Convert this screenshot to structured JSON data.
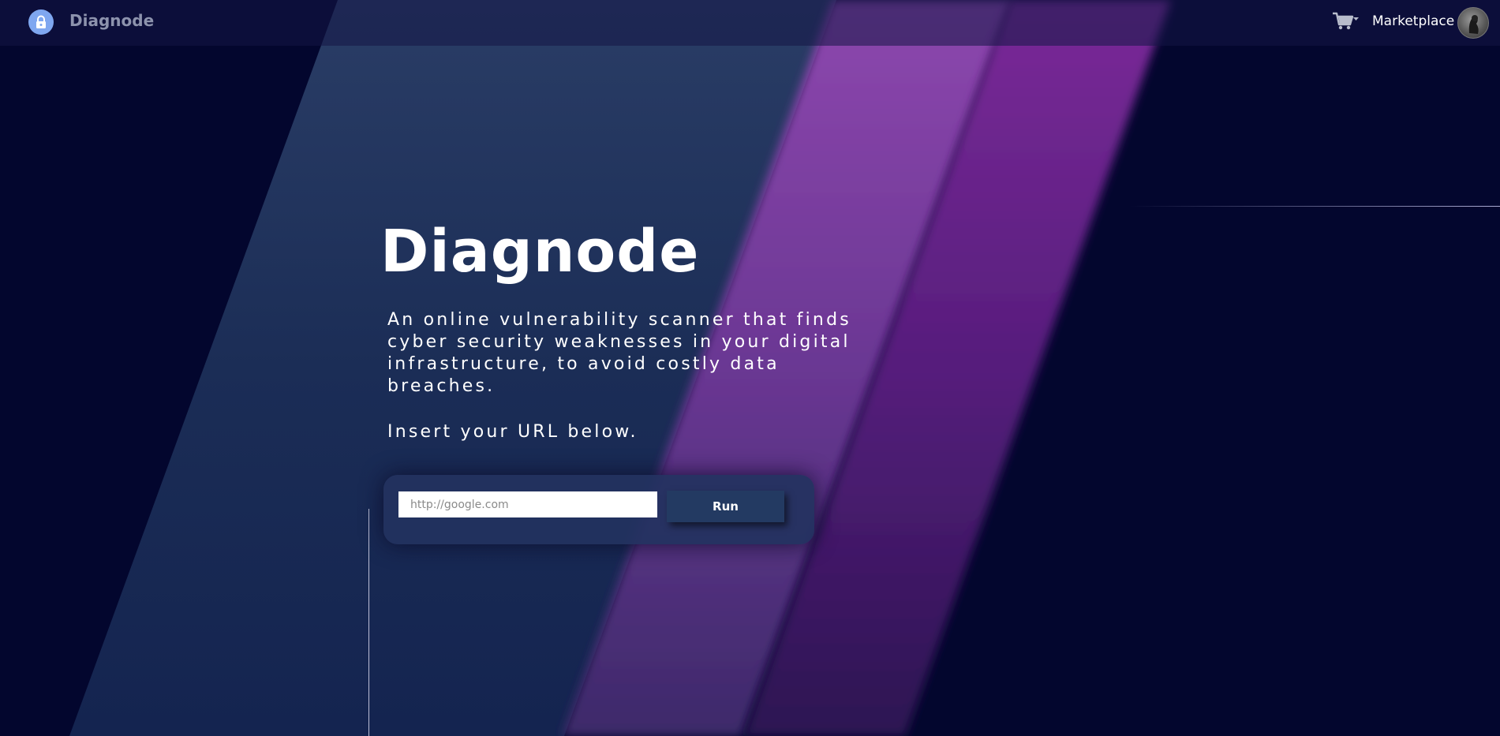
{
  "navbar": {
    "brand": "Diagnode",
    "marketplace_label": "Marketplace",
    "brand_icon": "lock-icon",
    "cart_icon": "shopping-cart-icon"
  },
  "hero": {
    "title": "Diagnode",
    "description": "An online vulnerability scanner that finds cyber security weaknesses in your digital infrastructure, to avoid costly data breaches.",
    "instruction": "Insert your URL below."
  },
  "scan_form": {
    "url_placeholder": "http://google.com",
    "url_value": "",
    "run_label": "Run"
  },
  "colors": {
    "background": "#03062e",
    "navbar": "#111444",
    "blue_stripe": "#1c2e55",
    "purple_stripe": "#7b3aa8",
    "button": "#233a62",
    "brand_icon": "#7fa7f0"
  }
}
